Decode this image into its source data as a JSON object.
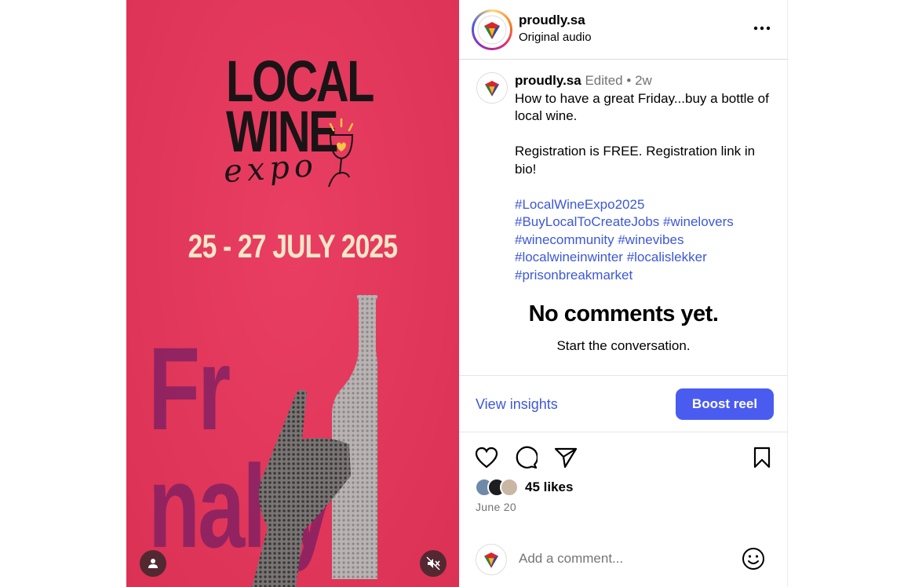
{
  "media": {
    "poster_title": "LOCAL\nWINE",
    "poster_subtitle": "expo",
    "poster_date": "25 - 27 JULY 2025",
    "poster_word": "Fr  nally"
  },
  "header": {
    "username": "proudly.sa",
    "audio": "Original audio",
    "more_icon": "more-horizontal-icon"
  },
  "caption": {
    "username": "proudly.sa",
    "edited": "Edited",
    "separator": "•",
    "age": "2w",
    "text": "How to have a great Friday...buy a bottle of local wine.\n\nRegistration is FREE. Registration link in bio!",
    "hashtags": [
      "#LocalWineExpo2025",
      "#BuyLocalToCreateJobs",
      "#winelovers",
      "#winecommunity",
      "#winevibes",
      "#localwineinwinter",
      "#localislekker",
      "#prisonbreakmarket"
    ]
  },
  "comments": {
    "empty_title": "No comments yet.",
    "empty_sub": "Start the conversation."
  },
  "insights": {
    "view_label": "View insights",
    "boost_label": "Boost reel"
  },
  "actions": {
    "icons": [
      "heart-icon",
      "comment-icon",
      "share-icon",
      "bookmark-icon"
    ]
  },
  "likes": {
    "count_label": "45 likes",
    "date": "June 20"
  },
  "composer": {
    "placeholder": "Add a comment..."
  },
  "colors": {
    "poster_bg": "#e8345a",
    "link": "#3c58d8",
    "boost": "#4a5cf0"
  }
}
